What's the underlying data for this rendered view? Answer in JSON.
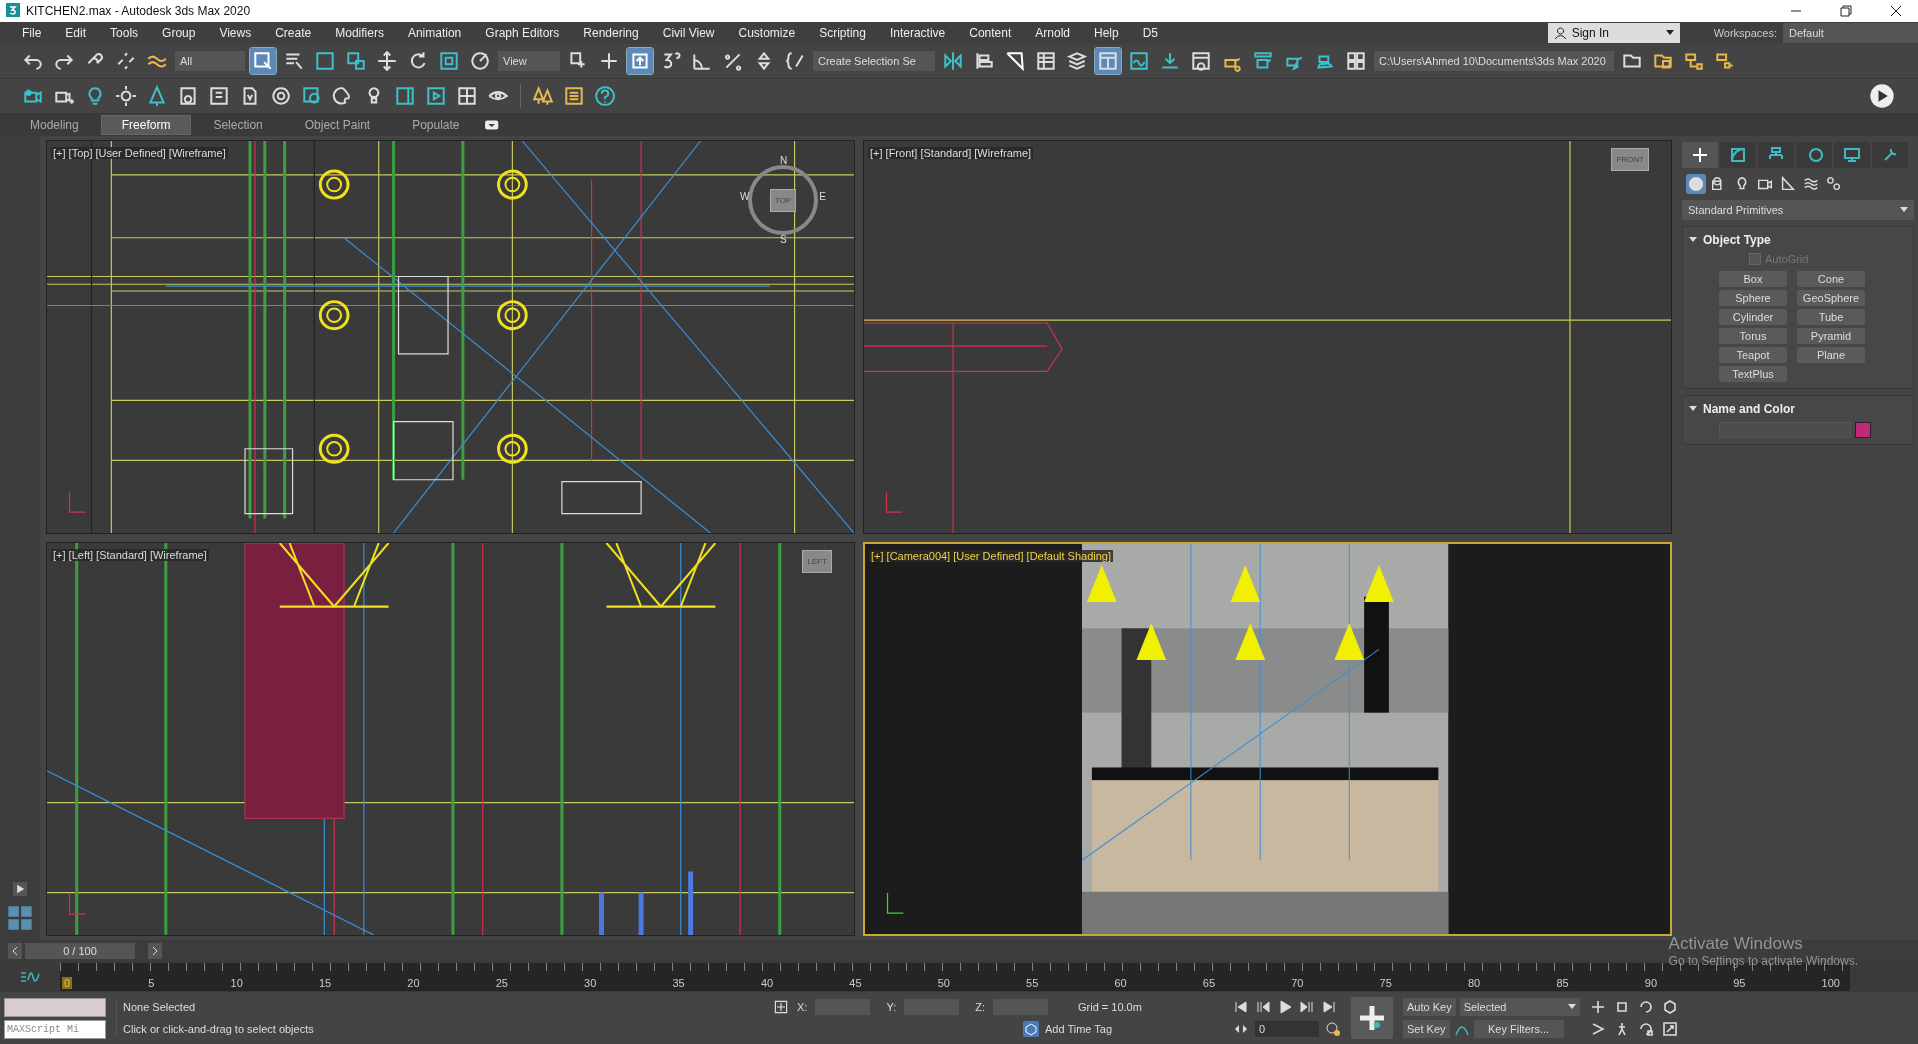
{
  "window": {
    "title": "KITCHEN2.max - Autodesk 3ds Max 2020"
  },
  "menu": [
    "File",
    "Edit",
    "Tools",
    "Group",
    "Views",
    "Create",
    "Modifiers",
    "Animation",
    "Graph Editors",
    "Rendering",
    "Civil View",
    "Customize",
    "Scripting",
    "Interactive",
    "Content",
    "Arnold",
    "Help",
    "D5"
  ],
  "account": {
    "sign_in": "Sign In",
    "workspaces_label": "Workspaces:",
    "workspace": "Default"
  },
  "toolbar": {
    "selection_filter": "All",
    "reference_coord": "View",
    "named_selection": "Create Selection Se",
    "project_path": "C:\\Users\\Ahmed 10\\Documents\\3ds Max 2020"
  },
  "ribbon_tabs": [
    {
      "label": "Modeling",
      "selected": false
    },
    {
      "label": "Freeform",
      "selected": true
    },
    {
      "label": "Selection",
      "selected": false
    },
    {
      "label": "Object Paint",
      "selected": false
    },
    {
      "label": "Populate",
      "selected": false
    }
  ],
  "viewports": [
    {
      "kind": "top",
      "label": "[+] [Top] [User Defined] [Wireframe]",
      "viewcube": "TOP",
      "compass": [
        "N",
        "E",
        "S",
        "W"
      ],
      "active": false
    },
    {
      "kind": "front",
      "label": "[+] [Front] [Standard] [Wireframe]",
      "viewcube": "FRONT",
      "active": false
    },
    {
      "kind": "left",
      "label": "[+] [Left] [Standard] [Wireframe]",
      "viewcube": "LEFT",
      "active": false
    },
    {
      "kind": "camera",
      "label": "[+] [Camera004] [User Defined] [Default Shading]",
      "active": true
    }
  ],
  "command_panel": {
    "tabs": [
      {
        "kind": "create",
        "selected": true
      },
      {
        "kind": "modify",
        "selected": false
      },
      {
        "kind": "hierarchy",
        "selected": false
      },
      {
        "kind": "motion",
        "selected": false
      },
      {
        "kind": "display",
        "selected": false
      },
      {
        "kind": "utilities",
        "selected": false
      }
    ],
    "categories": [
      {
        "kind": "geometry",
        "selected": true
      },
      {
        "kind": "shapes",
        "selected": false
      },
      {
        "kind": "lights",
        "selected": false
      },
      {
        "kind": "cameras",
        "selected": false
      },
      {
        "kind": "helpers",
        "selected": false
      },
      {
        "kind": "spacewarps",
        "selected": false
      },
      {
        "kind": "systems",
        "selected": false
      }
    ],
    "dropdown": "Standard Primitives",
    "object_type": {
      "title": "Object Type",
      "autogrid": {
        "label": "AutoGrid",
        "checked": false,
        "disabled": true
      },
      "buttons": [
        "Box",
        "Cone",
        "Sphere",
        "GeoSphere",
        "Cylinder",
        "Tube",
        "Torus",
        "Pyramid",
        "Teapot",
        "Plane",
        "TextPlus"
      ]
    },
    "name_and_color": {
      "title": "Name and Color",
      "color": "#c0287a"
    }
  },
  "time_slider": {
    "position": "0 / 100",
    "level": 0,
    "ticks": [
      "0",
      "5",
      "10",
      "15",
      "20",
      "25",
      "30",
      "35",
      "40",
      "45",
      "50",
      "55",
      "60",
      "65",
      "70",
      "75",
      "80",
      "85",
      "90",
      "95",
      "100"
    ]
  },
  "status_bar": {
    "maxscript": "MAXScript Mi",
    "selection": "None Selected",
    "prompt": "Click or click-and-drag to select objects",
    "x_label": "X:",
    "y_label": "Y:",
    "z_label": "Z:",
    "grid": "Grid = 10.0m",
    "add_time_tag": "Add Time Tag",
    "auto_key": "Auto Key",
    "key_mode": "Selected",
    "set_key": "Set Key",
    "key_filters": "Key Filters...",
    "frame": "0"
  },
  "activation": {
    "title": "Activate Windows",
    "hint": "Go to Settings to activate Windows."
  }
}
